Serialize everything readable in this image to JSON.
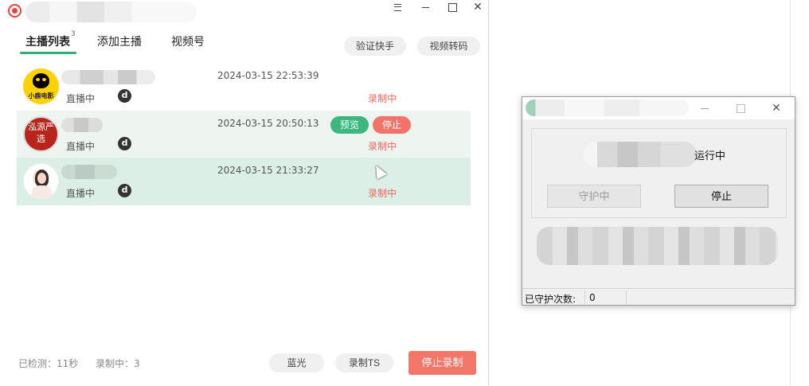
{
  "main_window": {
    "tabs": [
      {
        "label": "主播列表",
        "badge": "3"
      },
      {
        "label": "添加主播"
      },
      {
        "label": "视频号"
      }
    ],
    "top_buttons": {
      "verify": "验证快手",
      "transcode": "视频转码"
    },
    "streamers": [
      {
        "status": "直播中",
        "platform_icon": "d",
        "time": "2024-03-15 22:53:39",
        "recording": "录制中",
        "avatar_text": "小鹿电影"
      },
      {
        "status": "直播中",
        "platform_icon": "d",
        "time": "2024-03-15 20:50:13",
        "recording": "录制中",
        "avatar_text": "泓源严选",
        "preview_label": "预览",
        "stop_label": "停止"
      },
      {
        "status": "直播中",
        "platform_icon": "d",
        "time": "2024-03-15 21:33:27",
        "recording": "录制中"
      }
    ],
    "footer": {
      "checked": "已检测：11秒",
      "recording_count": "录制中：3",
      "bluray": "蓝光",
      "record_ts": "录制TS",
      "stop_recording": "停止录制"
    }
  },
  "guard_dialog": {
    "status_text": "运行中",
    "guarding_label": "守护中",
    "stop_label": "停止",
    "status_bar": {
      "label": "已守护次数:",
      "value": "0"
    }
  },
  "colors": {
    "accent_green": "#2eb07a",
    "recording_red": "#ec6a5e",
    "stop_button": "#f5776a"
  }
}
